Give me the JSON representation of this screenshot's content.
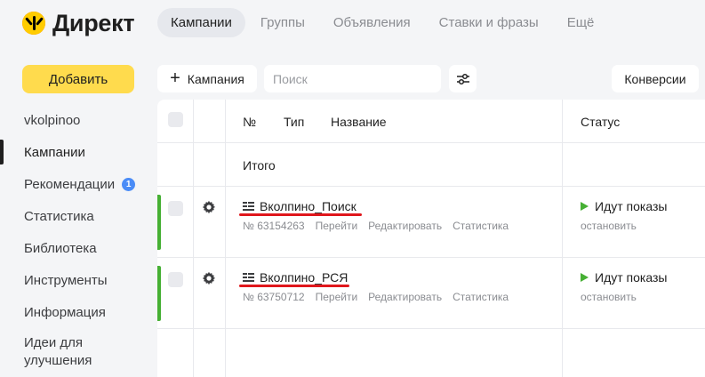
{
  "app": {
    "logo_text": "Директ",
    "brand_color": "#ffcc00"
  },
  "topnav": {
    "tabs": [
      {
        "label": "Кампании",
        "active": true
      },
      {
        "label": "Группы"
      },
      {
        "label": "Объявления"
      },
      {
        "label": "Ставки и фразы"
      },
      {
        "label": "Ещё"
      }
    ]
  },
  "sidebar": {
    "add_label": "Добавить",
    "items": [
      {
        "label": "vkolpinoo"
      },
      {
        "label": "Кампании",
        "active": true
      },
      {
        "label": "Рекомендации",
        "badge": "1"
      },
      {
        "label": "Статистика"
      },
      {
        "label": "Библиотека"
      },
      {
        "label": "Инструменты"
      },
      {
        "label": "Информация"
      },
      {
        "label": "Идеи для улучшения"
      }
    ]
  },
  "toolbar": {
    "add_campaign_label": "Кампания",
    "search_placeholder": "Поиск",
    "conversions_label": "Конверсии"
  },
  "table": {
    "columns": {
      "num": "№",
      "type": "Тип",
      "name": "Название",
      "status": "Статус"
    },
    "total_label": "Итого",
    "rows": [
      {
        "name": "Вколпино_Поиск",
        "number": "№ 63154263",
        "actions": [
          "Перейти",
          "Редактировать",
          "Статистика"
        ],
        "status": "Идут показы",
        "stop": "остановить"
      },
      {
        "name": "Вколпино_РСЯ",
        "number": "№ 63750712",
        "actions": [
          "Перейти",
          "Редактировать",
          "Статистика"
        ],
        "status": "Идут показы",
        "stop": "остановить"
      }
    ]
  }
}
